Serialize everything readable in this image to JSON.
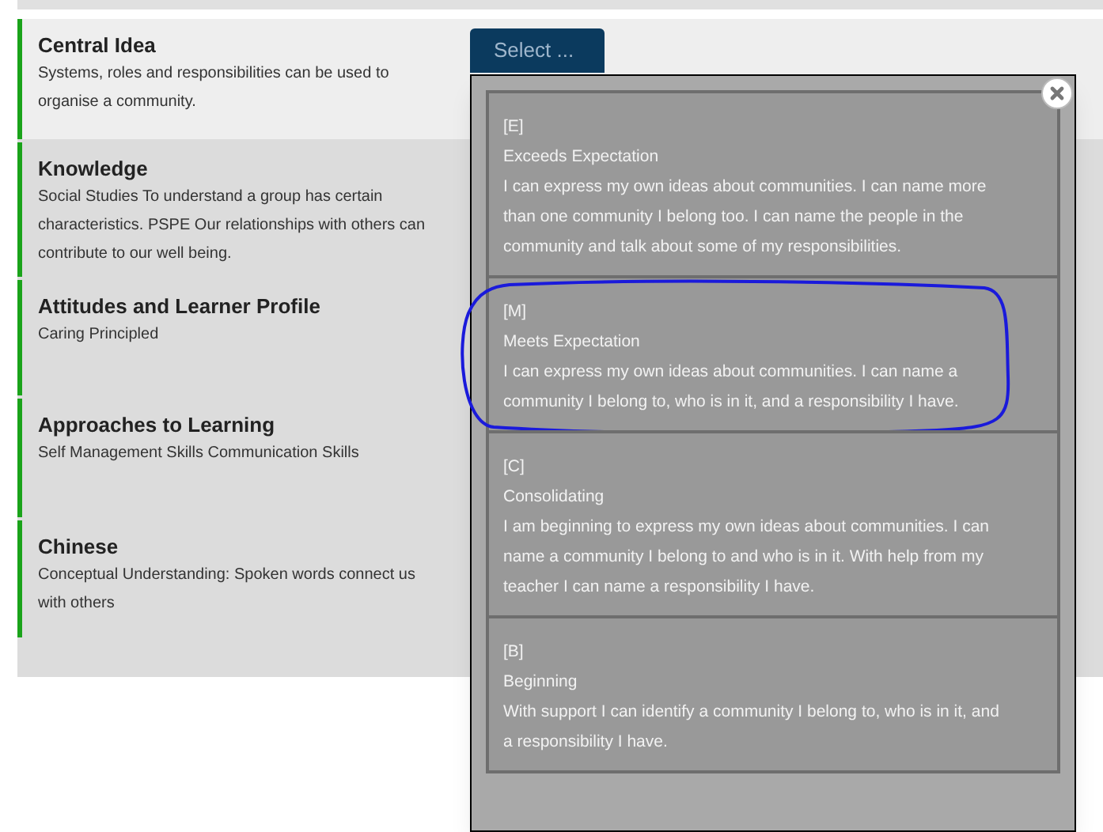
{
  "sections": [
    {
      "title": "Central Idea",
      "text": "Systems, roles and responsibilities can be used to organise a community.",
      "selected": true
    },
    {
      "title": "Knowledge",
      "text": "Social Studies To understand a group has certain characteristics. PSPE Our relationships with others can contribute to our well being.",
      "selected": false
    },
    {
      "title": "Attitudes and Learner Profile",
      "text": "Caring Principled",
      "selected": false
    },
    {
      "title": "Approaches to Learning",
      "text": "Self Management Skills Communication Skills",
      "selected": false
    },
    {
      "title": "Chinese",
      "text": "Conceptual Understanding: Spoken words connect us with others",
      "selected": false
    }
  ],
  "select_button": "Select ...",
  "options": [
    {
      "code": "[E]",
      "level": "Exceeds Expectation",
      "description": "I can express my own ideas about communities. I can name more than one community I belong too. I can name the people in the community and talk about some of my responsibilities.",
      "circled": false
    },
    {
      "code": "[M]",
      "level": "Meets Expectation",
      "description": "I can express my own ideas about communities. I can name a community I belong to, who is in it, and a responsibility I have.",
      "circled": true
    },
    {
      "code": "[C]",
      "level": "Consolidating",
      "description": "I am beginning to express my own ideas about communities. I can name a community I belong to and who is in it. With help from my teacher I can name a responsibility I have.",
      "circled": false
    },
    {
      "code": "[B]",
      "level": "Beginning",
      "description": "With support I can identify a community I belong to, who is in it, and a responsibility I have.",
      "circled": false
    }
  ]
}
